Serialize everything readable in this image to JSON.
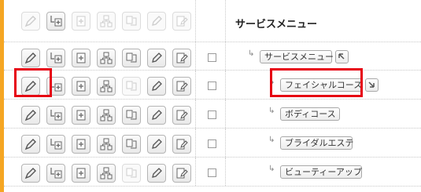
{
  "colors": {
    "accent": "#f5a623",
    "highlight": "#e60012"
  },
  "header": {
    "title": "サービスメニュー"
  },
  "action_icons": [
    "edit-icon",
    "add-child-icon",
    "add-item-icon",
    "add-branch-icon",
    "move-icon",
    "pencil-tool-icon",
    "edit-document-icon"
  ],
  "menu_rows": [
    {
      "label": "サービスメニュー",
      "arrow": "up-left-arrow-icon"
    },
    {
      "label": "フェイシャルコース",
      "arrow": "down-right-arrow-icon"
    },
    {
      "label": "ボディコース"
    },
    {
      "label": "ブライダルエステ"
    },
    {
      "label": "ビューティーアップ"
    }
  ]
}
